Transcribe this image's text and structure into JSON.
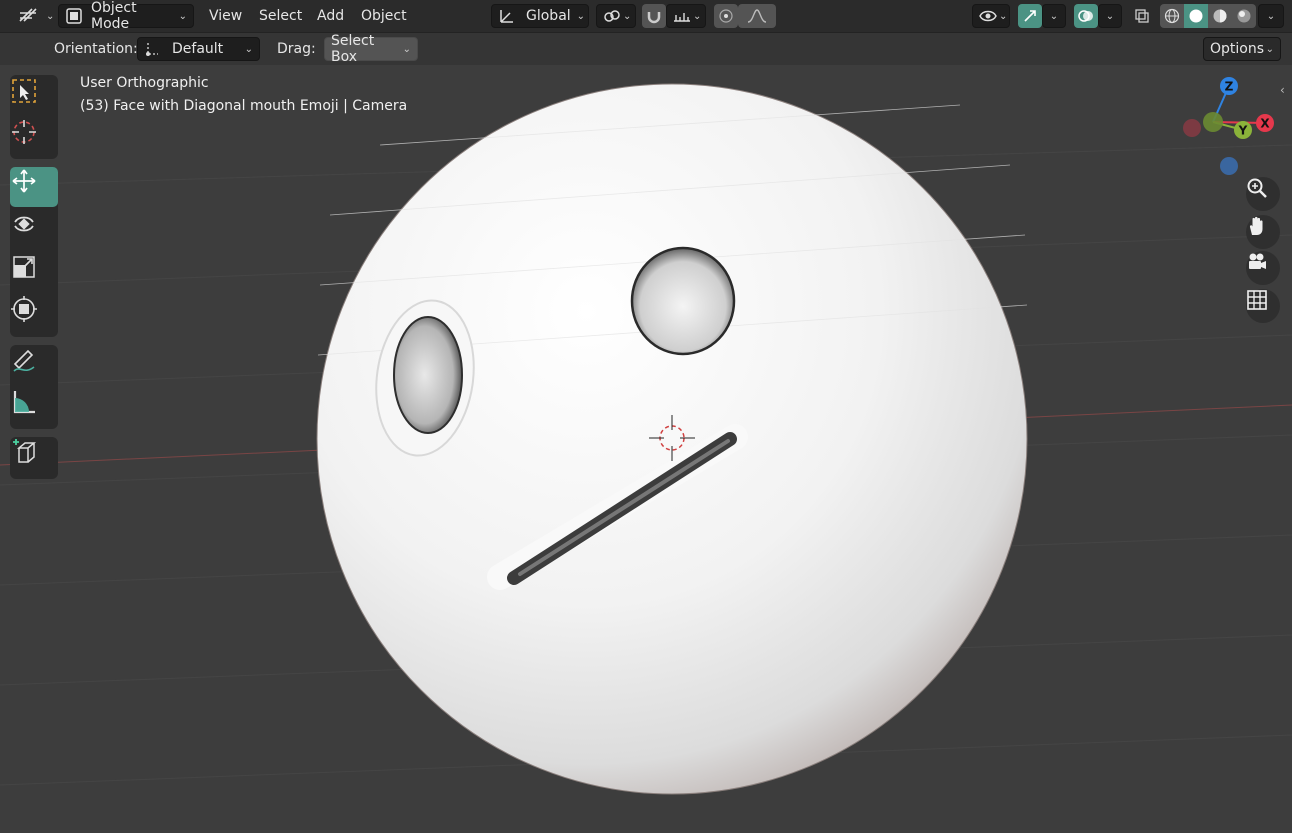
{
  "header": {
    "mode_label": "Object Mode",
    "menu": [
      "View",
      "Select",
      "Add",
      "Object"
    ],
    "transform_orientation": "Global"
  },
  "toolsettings": {
    "orientation_label": "Orientation:",
    "orientation_value": "Default",
    "drag_label": "Drag:",
    "drag_value": "Select Box",
    "options_label": "Options"
  },
  "viewport": {
    "view_name": "User Orthographic",
    "object_info": "(53) Face with Diagonal mouth Emoji | Camera"
  },
  "gizmo": {
    "z": "Z",
    "y": "Y",
    "x": "X",
    "colors": {
      "x": "#e5384c",
      "y": "#8bb33a",
      "z": "#2f83e2"
    }
  },
  "colors": {
    "accent": "#4b9384",
    "background": "#3d3d3d",
    "header": "#2b2b2b"
  }
}
